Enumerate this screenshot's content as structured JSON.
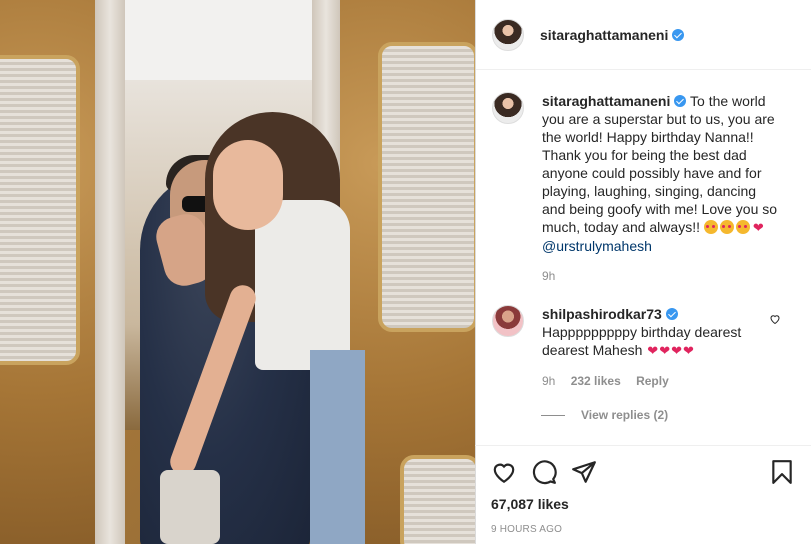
{
  "post": {
    "username": "sitaraghattamaneni",
    "verified": true
  },
  "caption": {
    "username": "sitaraghattamaneni",
    "text": "To the world you are a superstar but to us, you are the world! Happy birthday Nanna!! Thank you for being the best dad anyone could possibly have and for playing, laughing, singing, dancing and being goofy with me! Love you so much, today and always!!",
    "mention": "@urstrulymahesh",
    "time": "9h"
  },
  "comment": {
    "username": "shilpashirodkar73",
    "text": "Happpppppppy birthday dearest dearest Mahesh",
    "time": "9h",
    "likes": "232 likes",
    "reply_label": "Reply",
    "view_replies": "View replies (2)"
  },
  "footer": {
    "likes": "67,087 likes",
    "timestamp": "9 HOURS AGO"
  },
  "colors": {
    "verified_blue": "#3897f0",
    "mention_link": "#00376b",
    "heart_red": "#e0245e"
  },
  "icons": [
    "heart-icon",
    "comment-icon",
    "share-icon",
    "bookmark-icon",
    "verified-badge-icon"
  ]
}
